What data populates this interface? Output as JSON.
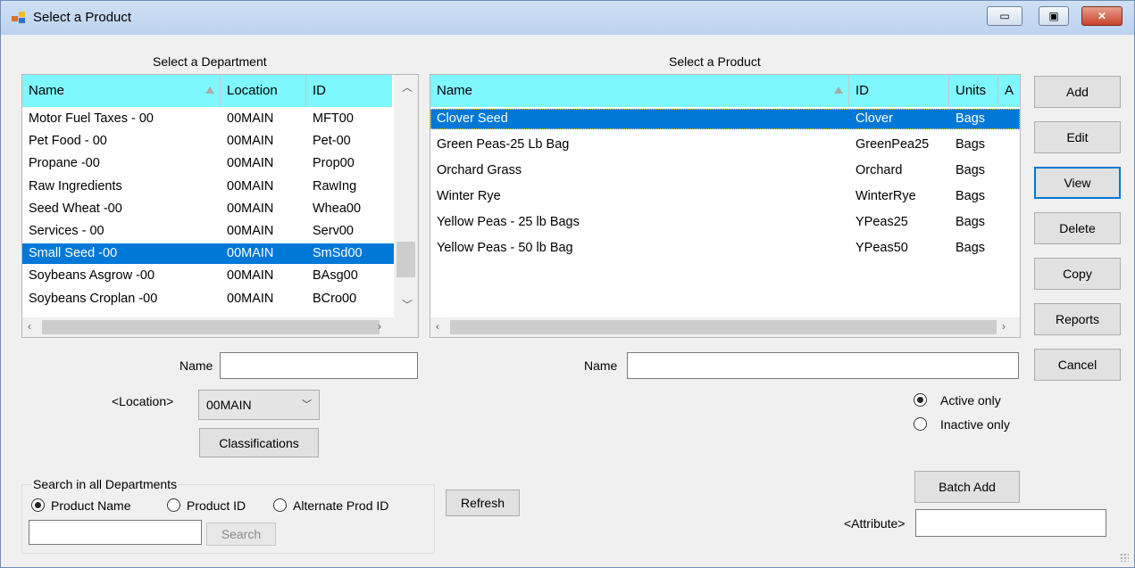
{
  "window": {
    "title": "Select a Product",
    "minimize_glyph": "▭",
    "maximize_glyph": "▣",
    "close_glyph": "✕"
  },
  "department": {
    "heading": "Select a Department",
    "columns": [
      "Name",
      "Location",
      "ID"
    ],
    "rows": [
      {
        "name": "Motor Fuel Taxes - 00",
        "location": "00MAIN",
        "id": "MFT00"
      },
      {
        "name": "Pet Food - 00",
        "location": "00MAIN",
        "id": "Pet-00"
      },
      {
        "name": "Propane -00",
        "location": "00MAIN",
        "id": "Prop00"
      },
      {
        "name": "Raw Ingredients",
        "location": "00MAIN",
        "id": "RawIng"
      },
      {
        "name": "Seed Wheat -00",
        "location": "00MAIN",
        "id": "Whea00"
      },
      {
        "name": "Services - 00",
        "location": "00MAIN",
        "id": "Serv00"
      },
      {
        "name": "Small Seed -00",
        "location": "00MAIN",
        "id": "SmSd00"
      },
      {
        "name": "Soybeans Asgrow -00",
        "location": "00MAIN",
        "id": "BAsg00"
      },
      {
        "name": "Soybeans Croplan -00",
        "location": "00MAIN",
        "id": "BCro00"
      }
    ],
    "selected_index": 6,
    "name_label": "Name",
    "name_value": "",
    "location_label": "<Location>",
    "location_value": "00MAIN",
    "classifications_label": "Classifications"
  },
  "search": {
    "group_title": "Search in all Departments",
    "options": [
      "Product Name",
      "Product ID",
      "Alternate Prod ID"
    ],
    "selected": "Product Name",
    "value": "",
    "search_button": "Search"
  },
  "refresh_label": "Refresh",
  "product": {
    "heading": "Select a Product",
    "columns": [
      "Name",
      "ID",
      "Units",
      "A"
    ],
    "rows": [
      {
        "name": "Clover Seed",
        "id": "Clover",
        "units": "Bags"
      },
      {
        "name": "Green Peas-25 Lb Bag",
        "id": "GreenPea25",
        "units": "Bags"
      },
      {
        "name": "Orchard Grass",
        "id": "Orchard",
        "units": "Bags"
      },
      {
        "name": "Winter Rye",
        "id": "WinterRye",
        "units": "Bags"
      },
      {
        "name": "Yellow Peas - 25 lb Bags",
        "id": "YPeas25",
        "units": "Bags"
      },
      {
        "name": "Yellow Peas - 50 lb Bag",
        "id": "YPeas50",
        "units": "Bags"
      }
    ],
    "selected_index": 0,
    "name_label": "Name",
    "name_value": "",
    "status_options": [
      "Active only",
      "Inactive only"
    ],
    "status_selected": "Active only",
    "batch_add_label": "Batch Add",
    "attribute_label": "<Attribute>",
    "attribute_value": ""
  },
  "actions": [
    "Add",
    "Edit",
    "View",
    "Delete",
    "Copy",
    "Reports",
    "Cancel"
  ],
  "focused_action": "View",
  "colors": {
    "header": "#7ff7ff",
    "selection": "#0078d7",
    "focus": "#0078d7"
  }
}
